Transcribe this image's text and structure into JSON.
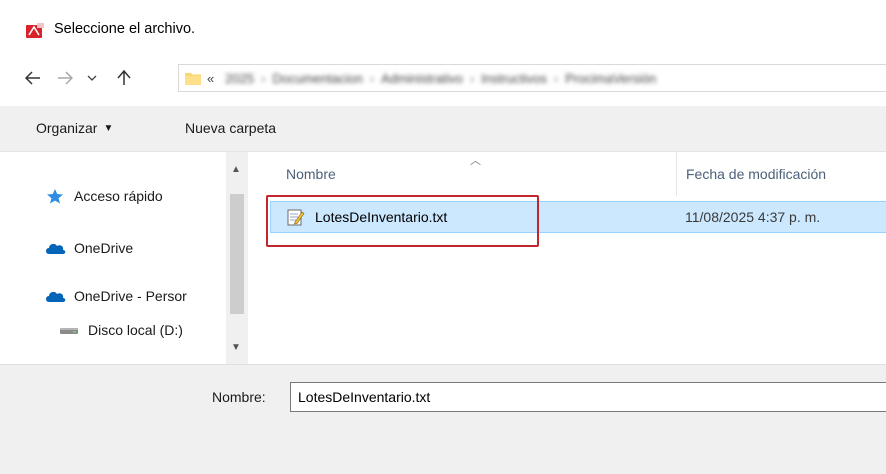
{
  "window": {
    "title": "Seleccione el archivo.",
    "icon": "pdf-app-icon"
  },
  "nav": {
    "back_icon": "arrow-left-icon",
    "forward_icon": "arrow-right-icon",
    "recent_icon": "chevron-down-icon",
    "up_icon": "arrow-up-icon"
  },
  "address": {
    "prefix": "«",
    "crumbs": [
      "2025",
      "Documentacion",
      "Administrativo",
      "Instructivos",
      "ProcimaVersión"
    ],
    "separator": "›"
  },
  "toolbar": {
    "organize_label": "Organizar",
    "organize_caret": "▼",
    "new_folder_label": "Nueva carpeta"
  },
  "navpane": {
    "items": [
      {
        "label": "Acceso rápido",
        "icon": "pin-star-icon"
      },
      {
        "label": "OneDrive",
        "icon": "cloud-icon"
      },
      {
        "label": "OneDrive - Persor",
        "icon": "cloud-icon"
      },
      {
        "label": "Disco local (D:)",
        "icon": "drive-icon"
      }
    ]
  },
  "files": {
    "columns": {
      "name": "Nombre",
      "date": "Fecha de modificación"
    },
    "rows": [
      {
        "name": "LotesDeInventario.txt",
        "date": "11/08/2025 4:37 p. m.",
        "icon": "text-file-icon",
        "selected": true
      }
    ]
  },
  "footer": {
    "filename_label": "Nombre:",
    "filename_value": "LotesDeInventario.txt"
  },
  "colors": {
    "selection": "#cce8ff",
    "highlight": "#c0262c",
    "onedrive": "#0364b8"
  }
}
